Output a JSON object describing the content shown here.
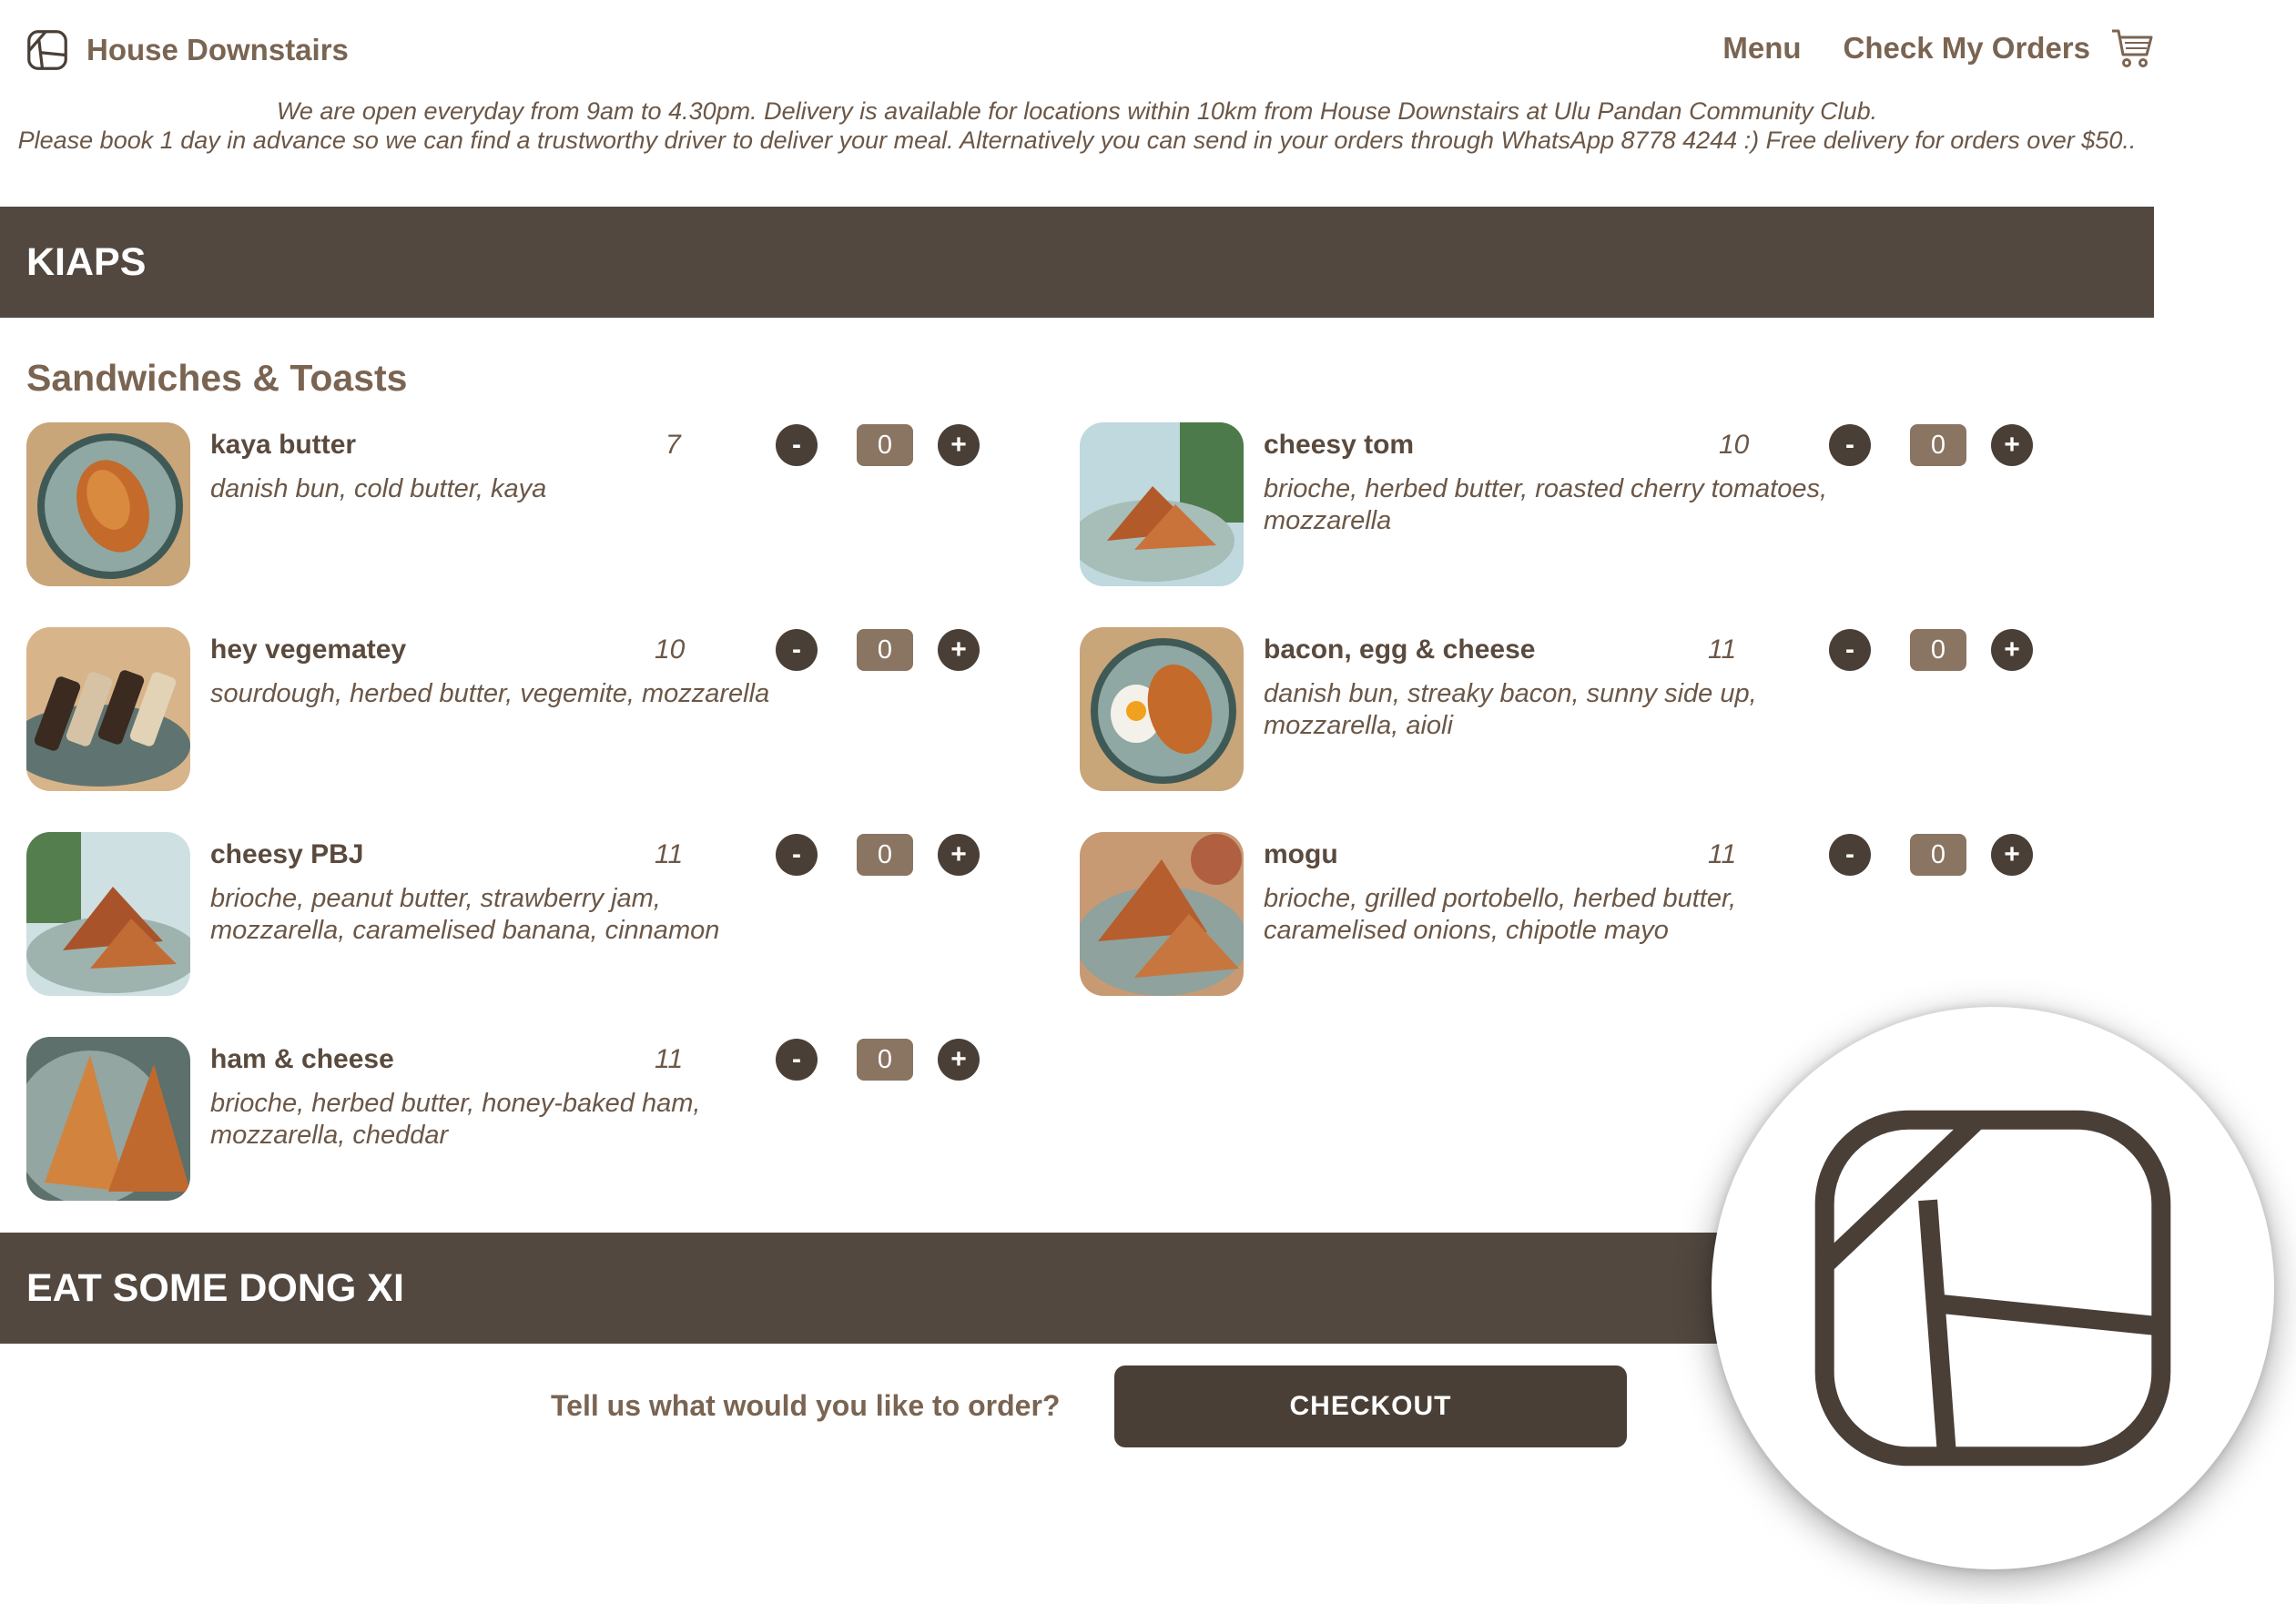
{
  "header": {
    "brand_name": "House Downstairs",
    "nav": {
      "menu": "Menu",
      "check_orders": "Check My Orders"
    },
    "icons": {
      "logo": "house-downstairs-logo",
      "cart": "shopping-cart-icon"
    }
  },
  "notice": {
    "line1": "We are open everyday from 9am to 4.30pm. Delivery is available for locations within 10km from House Downstairs at Ulu Pandan Community Club.",
    "line2": "Please book 1 day in advance so we can find a trustworthy driver to deliver your meal. Alternatively you can send in your orders through WhatsApp 8778 4244 :) Free delivery for orders over $50.."
  },
  "sections": [
    {
      "title": "KIAPS",
      "subsection": "Sandwiches & Toasts",
      "items": [
        {
          "name": "kaya butter",
          "price": "7",
          "desc": "danish bun, cold butter, kaya",
          "qty": "0"
        },
        {
          "name": "cheesy tom",
          "price": "10",
          "desc": "brioche, herbed butter, roasted cherry tomatoes, mozzarella",
          "qty": "0"
        },
        {
          "name": "hey vegematey",
          "price": "10",
          "desc": "sourdough, herbed butter, vegemite, mozzarella",
          "qty": "0"
        },
        {
          "name": "bacon, egg & cheese",
          "price": "11",
          "desc": "danish bun, streaky bacon, sunny side up, mozzarella, aioli",
          "qty": "0"
        },
        {
          "name": "cheesy PBJ",
          "price": "11",
          "desc": "brioche, peanut butter, strawberry jam, mozzarella, caramelised banana, cinnamon",
          "qty": "0"
        },
        {
          "name": "mogu",
          "price": "11",
          "desc": "brioche, grilled portobello, herbed butter, caramelised onions, chipotle mayo",
          "qty": "0"
        },
        {
          "name": "ham & cheese",
          "price": "11",
          "desc": "brioche, herbed butter, honey-baked ham, mozzarella, cheddar",
          "qty": "0"
        }
      ]
    },
    {
      "title": "EAT SOME DONG XI"
    }
  ],
  "qty_controls": {
    "minus": "-",
    "plus": "+"
  },
  "footer": {
    "prompt": "Tell us what would you like to order?",
    "checkout": "CHECKOUT"
  },
  "colors": {
    "band": "#524840",
    "accent": "#7a6452",
    "button": "#4a3f36",
    "counter": "#8a7462"
  }
}
